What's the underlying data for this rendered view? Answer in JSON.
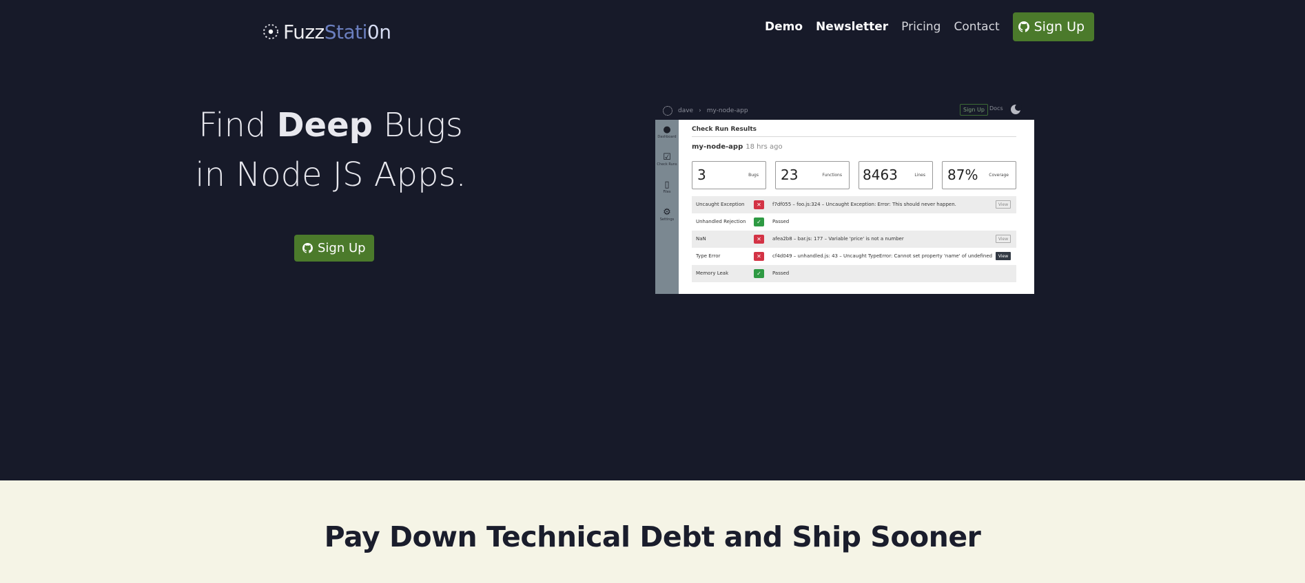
{
  "nav": {
    "logo": {
      "part1": "Fuzz",
      "part2": "Stati",
      "part3": "0n"
    },
    "links": [
      {
        "label": "Demo",
        "bold": true
      },
      {
        "label": "Newsletter",
        "bold": true
      },
      {
        "label": "Pricing",
        "bold": false
      },
      {
        "label": "Contact",
        "bold": false
      }
    ],
    "signup_label": "Sign Up",
    "signup_icon": "github-icon"
  },
  "hero": {
    "headline_pre": "Find ",
    "headline_bold": "Deep",
    "headline_post": " Bugs",
    "headline_line2": "in Node JS Apps.",
    "signup_label": "Sign Up",
    "signup_icon": "github-icon"
  },
  "screenshot": {
    "breadcrumb_user": "dave",
    "breadcrumb_sep": "›",
    "breadcrumb_app": "my-node-app",
    "signup_label": "Sign Up",
    "docs_label": "Docs",
    "sidebar": [
      {
        "icon": "brain-icon",
        "label": "Dashboard"
      },
      {
        "icon": "clipboard-check-icon",
        "label": "Check Runs"
      },
      {
        "icon": "files-icon",
        "label": "Files"
      },
      {
        "icon": "settings-icon",
        "label": "Settings"
      }
    ],
    "title": "Check Run Results",
    "app_name": "my-node-app",
    "app_time": "18 hrs ago",
    "stats": [
      {
        "value": "3",
        "label": "Bugs"
      },
      {
        "value": "23",
        "label": "Functions"
      },
      {
        "value": "8463",
        "label": "Lines"
      },
      {
        "value": "87%",
        "label": "Coverage"
      }
    ],
    "rows": [
      {
        "name": "Uncaught Exception",
        "status": "fail",
        "message": "f7df055 – foo.js:324 – Uncaught Exception: Error: This should never happen.",
        "view": "View",
        "view_dark": false
      },
      {
        "name": "Unhandled Rejection",
        "status": "pass",
        "message": "Passed",
        "view": "",
        "view_dark": false
      },
      {
        "name": "NaN",
        "status": "fail",
        "message": "afea2b8 – bar.js: 177 – Variable 'price' is not a number",
        "view": "View",
        "view_dark": false
      },
      {
        "name": "Type Error",
        "status": "fail",
        "message": "cf4d049 – unhandled.js: 43 – Uncaught TypeError: Cannot set property 'name' of undefined",
        "view": "View",
        "view_dark": true
      },
      {
        "name": "Memory Leak",
        "status": "pass",
        "message": "Passed",
        "view": "",
        "view_dark": false
      }
    ]
  },
  "section": {
    "title": "Pay Down Technical Debt and Ship Sooner"
  },
  "colors": {
    "background": "#171a29",
    "accent_green": "#4b7a2b",
    "section_background": "#f5f4e6"
  }
}
